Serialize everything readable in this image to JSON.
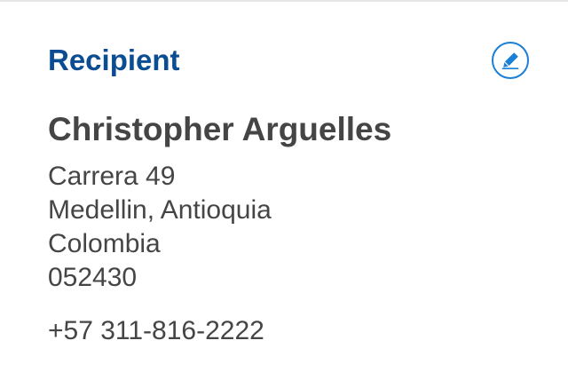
{
  "recipient": {
    "section_title": "Recipient",
    "edit_icon": "pencil-icon",
    "name": "Christopher Arguelles",
    "address_lines": [
      "Carrera 49",
      "Medellin, Antioquia",
      "Colombia",
      "052430"
    ],
    "phone": "+57 311-816-2222"
  },
  "colors": {
    "title": "#0b4d92",
    "accent": "#1a7fd6",
    "text": "#454545",
    "divider": "#e6e6e6"
  }
}
